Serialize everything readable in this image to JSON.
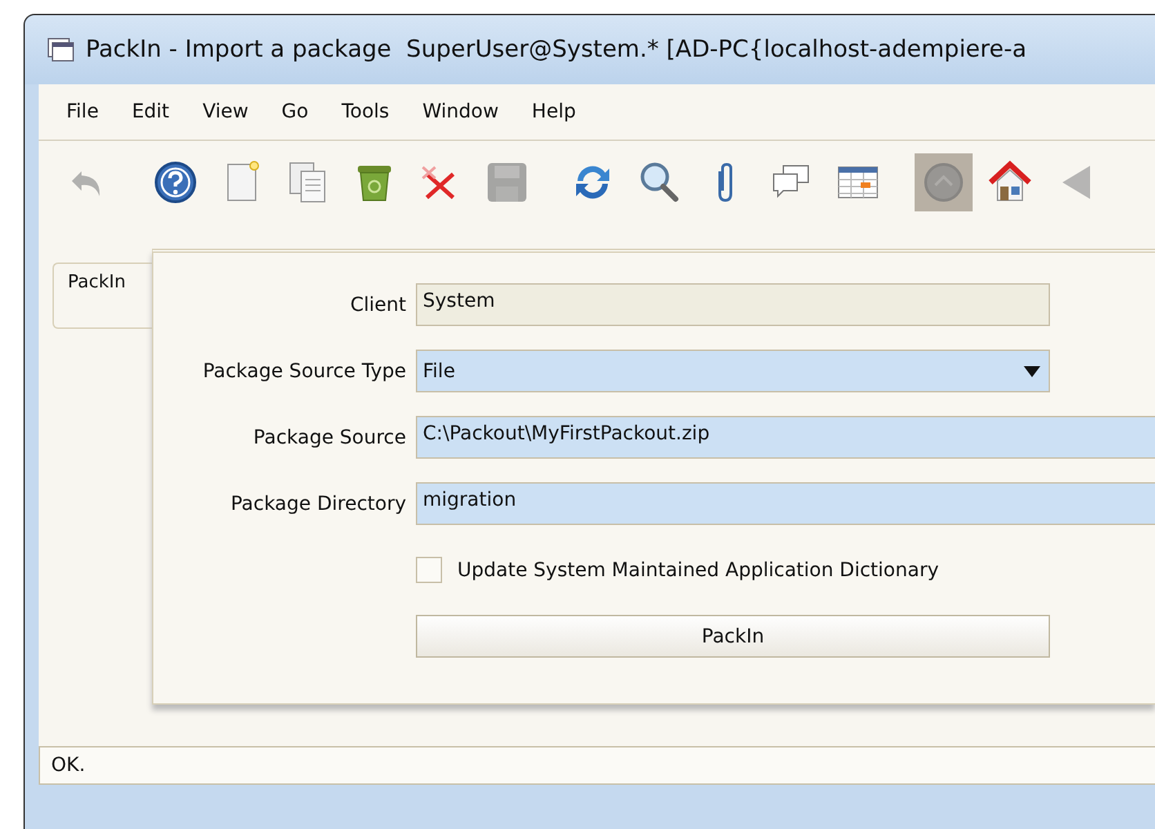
{
  "window": {
    "title": "PackIn - Import a package  SuperUser@System.* [AD-PC{localhost-adempiere-a"
  },
  "menu": [
    "File",
    "Edit",
    "View",
    "Go",
    "Tools",
    "Window",
    "Help"
  ],
  "toolbar": [
    {
      "kind": "undo",
      "disabled": true,
      "selected": false
    },
    {
      "kind": "help",
      "disabled": false,
      "selected": false
    },
    {
      "kind": "new",
      "disabled": false,
      "selected": false
    },
    {
      "kind": "copy",
      "disabled": false,
      "selected": false
    },
    {
      "kind": "delete",
      "disabled": false,
      "selected": false
    },
    {
      "kind": "delete-selection",
      "disabled": false,
      "selected": false
    },
    {
      "kind": "save",
      "disabled": true,
      "selected": false
    },
    {
      "kind": "refresh",
      "disabled": false,
      "selected": false
    },
    {
      "kind": "find",
      "disabled": false,
      "selected": false
    },
    {
      "kind": "attach",
      "disabled": false,
      "selected": false
    },
    {
      "kind": "chat",
      "disabled": false,
      "selected": false
    },
    {
      "kind": "grid",
      "disabled": false,
      "selected": false
    },
    {
      "kind": "history",
      "disabled": true,
      "selected": true
    },
    {
      "kind": "home",
      "disabled": false,
      "selected": false
    },
    {
      "kind": "back",
      "disabled": true,
      "selected": false
    }
  ],
  "tabs": [
    {
      "label": "PackIn",
      "selected": true
    }
  ],
  "form": [
    {
      "kind": "text",
      "label": "Client",
      "value": "System",
      "readonly": true,
      "wide": false
    },
    {
      "kind": "select",
      "label": "Package Source Type",
      "value": "File",
      "readonly": false,
      "wide": false
    },
    {
      "kind": "text",
      "label": "Package Source",
      "value": "C:\\Packout\\MyFirstPackout.zip",
      "readonly": false,
      "wide": true
    },
    {
      "kind": "text",
      "label": "Package Directory",
      "value": "migration",
      "readonly": false,
      "wide": true
    },
    {
      "kind": "checkbox",
      "label": "Update System Maintained Application Dictionary",
      "checked": false
    },
    {
      "kind": "button",
      "label": "PackIn"
    }
  ],
  "status_bar": "OK."
}
